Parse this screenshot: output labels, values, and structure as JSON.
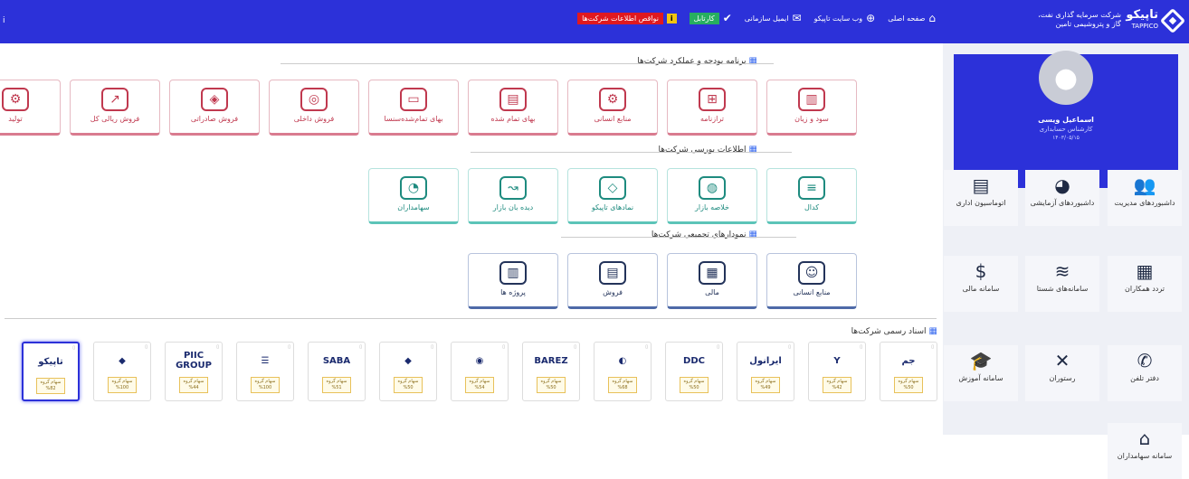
{
  "topbar": {
    "left_char": "i",
    "logo_text": "تاپیکو",
    "logo_sub": "TAPPICO",
    "company_line1": "شرکت سرمایه گذاری نفت،",
    "company_line2": "گاز و پتروشیمی تامین",
    "nav": [
      {
        "label": "صفحه اصلی",
        "icon": "home-icon",
        "glyph": "⌂"
      },
      {
        "label": "وب سایت تاپیکو",
        "icon": "globe-icon",
        "glyph": "⊕"
      },
      {
        "label": "ایمیل سازمانی",
        "icon": "mail-icon",
        "glyph": "✉"
      }
    ],
    "kartable": "کارتابل",
    "deficit": "نواقص اطلاعات شرکت‌ها"
  },
  "profile": {
    "name": "اسماعیل ویسی",
    "role": "کارشناس حسابداری",
    "date": "۱۴۰۳/۰۵/۱۵"
  },
  "sidebar_tiles": [
    {
      "label": "داشبوردهای مدیریت",
      "glyph": "👥"
    },
    {
      "label": "داشبوردهای آزمایشی",
      "glyph": "◕"
    },
    {
      "label": "اتوماسیون اداری",
      "glyph": "▤"
    },
    {
      "label": "تردد همکاران",
      "glyph": "▦"
    },
    {
      "label": "سامانه‌های شستا",
      "glyph": "≋"
    },
    {
      "label": "سامانه مالی",
      "glyph": "$"
    },
    {
      "label": "دفتر تلفن",
      "glyph": "✆"
    },
    {
      "label": "رستوران",
      "glyph": "✕"
    },
    {
      "label": "سامانه آموزش",
      "glyph": "🎓"
    },
    {
      "label": "سامانه سهامداران",
      "glyph": "⌂"
    }
  ],
  "sections": {
    "budget": "برنامه بودجه و عملکرد شرکت‌ها",
    "bourse": "اطلاعات بورسی شرکت‌ها",
    "charts": "نمودارهای تجمیعی شرکت‌ها",
    "docs": "اسناد رسمی شرکت‌ها"
  },
  "budget_cards": [
    "سود و زیان",
    "ترازنامه",
    "منابع انسانی",
    "بهای تمام شده",
    "بهای تمام‌شده‌سنسا",
    "فروش داخلی",
    "فروش صادراتی",
    "فروش ریالی کل",
    "تولید"
  ],
  "bourse_cards": [
    "کدال",
    "خلاصه بازار",
    "نمادهای تاپیکو",
    "دیده بان بازار",
    "سهامداران"
  ],
  "chart_cards": [
    "منابع انسانی",
    "مالی",
    "فروش",
    "پروژه ها"
  ],
  "docs": [
    {
      "logo": "جم",
      "share": "سهام گروه",
      "pct": "%50"
    },
    {
      "logo": "Y",
      "share": "سهام گروه",
      "pct": "%42"
    },
    {
      "logo": "ایرانول",
      "share": "سهام گروه",
      "pct": "%49"
    },
    {
      "logo": "DDC",
      "share": "سهام گروه",
      "pct": "%50"
    },
    {
      "logo": "◐",
      "share": "سهام گروه",
      "pct": "%68"
    },
    {
      "logo": "BAREZ",
      "share": "سهام گروه",
      "pct": "%50"
    },
    {
      "logo": "◉",
      "share": "سهام گروه",
      "pct": "%54"
    },
    {
      "logo": "◆",
      "share": "سهام گروه",
      "pct": "%50"
    },
    {
      "logo": "SABA",
      "share": "سهام گروه",
      "pct": "%51"
    },
    {
      "logo": "☰",
      "share": "سهام گروه",
      "pct": "%100"
    },
    {
      "logo": "PIIC GROUP",
      "share": "سهام گروه",
      "pct": "%44"
    },
    {
      "logo": "◆",
      "share": "سهام گروه",
      "pct": "%100"
    },
    {
      "logo": "تاپیکو",
      "share": "سهام گروه",
      "pct": "%82"
    }
  ]
}
